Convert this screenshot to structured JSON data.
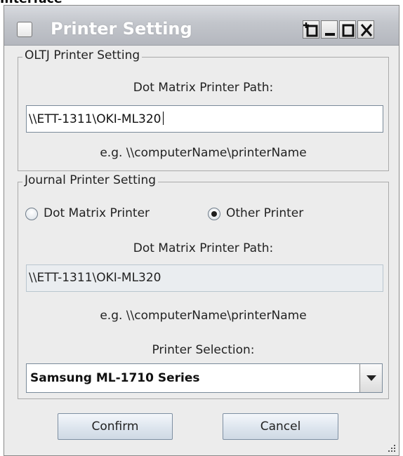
{
  "page_header": "Interface",
  "window": {
    "title": "Printer Setting",
    "controls": [
      "pin-icon",
      "minimize-icon",
      "maximize-icon",
      "close-icon"
    ]
  },
  "oltj": {
    "group_title": "OLTJ Printer Setting",
    "path_label": "Dot Matrix Printer Path:",
    "path_value": "\\\\ETT-1311\\OKI-ML320",
    "example": "e.g. \\\\computerName\\printerName"
  },
  "journal": {
    "group_title": "Journal Printer Setting",
    "radio_dot_matrix": "Dot Matrix Printer",
    "radio_other": "Other Printer",
    "selected_radio": "Other Printer",
    "path_label": "Dot Matrix Printer Path:",
    "path_value": "\\\\ETT-1311\\OKI-ML320",
    "example": "e.g. \\\\computerName\\printerName",
    "selection_label": "Printer Selection:",
    "selection_value": "Samsung ML-1710 Series"
  },
  "buttons": {
    "confirm": "Confirm",
    "cancel": "Cancel"
  },
  "colors": {
    "titlebar": "#c2c5cb",
    "window_bg": "#ececec",
    "button_bg": "#dde5ee"
  }
}
